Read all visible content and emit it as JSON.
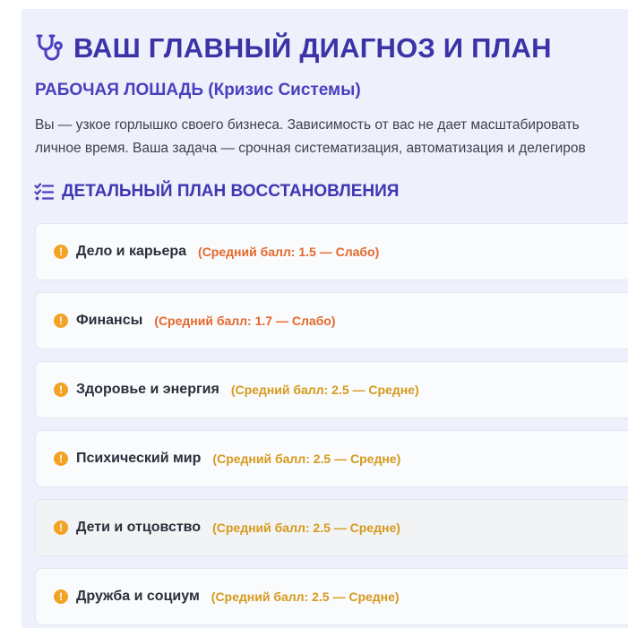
{
  "colors": {
    "accent": "#3b33a6",
    "panel_bg": "#eef0fb",
    "warning_icon": "#f4a223",
    "score_weak": "#e4672b",
    "score_mid": "#d59a1b"
  },
  "header": {
    "icon": "stethoscope-icon",
    "title": "ВАШ ГЛАВНЫЙ ДИАГНОЗ И ПЛАН",
    "subtitle": "РАБОЧАЯ ЛОШАДЬ (Кризис Системы)",
    "description_line1": "Вы — узкое горлышко своего бизнеса. Зависимость от вас не дает масштабировать",
    "description_line2": "личное время. Ваша задача — срочная систематизация, автоматизация и делегиров"
  },
  "plan": {
    "icon": "checklist-icon",
    "title": "ДЕТАЛЬНЫЙ ПЛАН ВОССТАНОВЛЕНИЯ",
    "items": [
      {
        "icon": "warning-icon",
        "name": "Дело и карьера",
        "score": "(Средний балл: 1.5 — Слабо)",
        "level": "weak"
      },
      {
        "icon": "warning-icon",
        "name": "Финансы",
        "score": "(Средний балл: 1.7 — Слабо)",
        "level": "weak"
      },
      {
        "icon": "warning-icon",
        "name": "Здоровье и энергия",
        "score": "(Средний балл: 2.5 — Средне)",
        "level": "mid"
      },
      {
        "icon": "warning-icon",
        "name": "Психический мир",
        "score": "(Средний балл: 2.5 — Средне)",
        "level": "mid"
      },
      {
        "icon": "warning-icon",
        "name": "Дети и отцовство",
        "score": "(Средний балл: 2.5 — Средне)",
        "level": "mid"
      },
      {
        "icon": "warning-icon",
        "name": "Дружба и социум",
        "score": "(Средний балл: 2.5 — Средне)",
        "level": "mid"
      }
    ]
  }
}
